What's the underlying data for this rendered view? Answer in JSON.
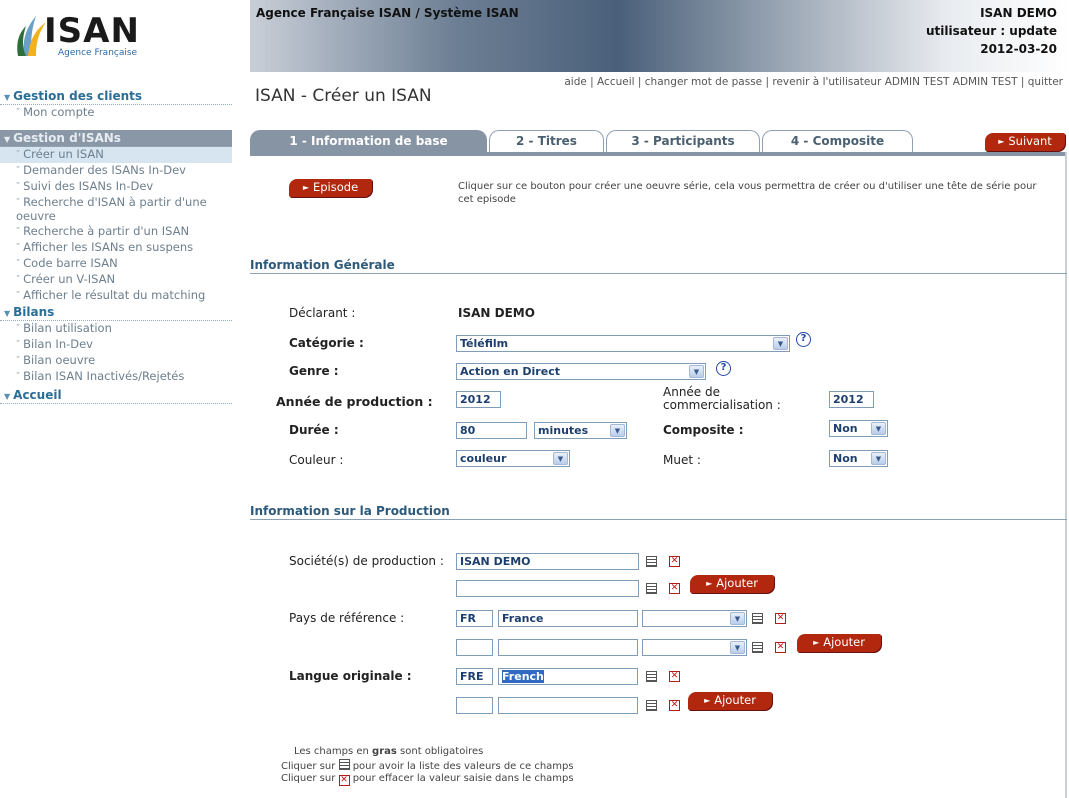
{
  "header": {
    "logo_text": "ISAN",
    "logo_sub": "Agence Française",
    "banner_title": "Agence Française ISAN / Système ISAN",
    "user_org": "ISAN DEMO",
    "user_line": "utilisateur : update",
    "date": "2012-03-20",
    "links": [
      "aide",
      "Accueil",
      "changer mot de passe",
      "revenir à l'utilisateur ADMIN TEST ADMIN TEST",
      "quitter"
    ]
  },
  "page_title": "ISAN - Créer un ISAN",
  "sidebar": {
    "sections": [
      {
        "title": "Gestion des clients",
        "items": [
          "Mon compte"
        ]
      },
      {
        "title": "Gestion d'ISANs",
        "items": [
          "Créer un ISAN",
          "Demander des ISANs In-Dev",
          "Suivi des ISANs In-Dev",
          "Recherche d'ISAN à partir d'une oeuvre",
          "Recherche à partir d'un ISAN",
          "Afficher les ISANs en suspens",
          "Code barre ISAN",
          "Créer un V-ISAN",
          "Afficher le résultat du matching"
        ]
      },
      {
        "title": "Bilans",
        "items": [
          "Bilan utilisation",
          "Bilan In-Dev",
          "Bilan oeuvre",
          "Bilan ISAN Inactivés/Rejetés"
        ]
      },
      {
        "title": "Accueil",
        "items": []
      }
    ]
  },
  "tabs": [
    "1 - Information de base",
    "2 - Titres",
    "3 - Participants",
    "4 - Composite"
  ],
  "next_button": "Suivant",
  "episode": {
    "button": "Episode",
    "hint": "Cliquer sur ce bouton pour créer une oeuvre série, cela vous permettra de créer ou d'utiliser une tête de série pour cet episode"
  },
  "general": {
    "title": "Information Générale",
    "declarant_label": "Déclarant :",
    "declarant_value": "ISAN DEMO",
    "categorie_label": "Catégorie :",
    "categorie_value": "Téléfilm",
    "genre_label": "Genre :",
    "genre_value": "Action en Direct",
    "annee_prod_label": "Année de production :",
    "annee_prod_value": "2012",
    "annee_comm_label_1": "Année de",
    "annee_comm_label_2": "commercialisation :",
    "annee_comm_value": "2012",
    "duree_label": "Durée :",
    "duree_value": "80",
    "duree_unit": "minutes",
    "composite_label": "Composite :",
    "composite_value": "Non",
    "couleur_label": "Couleur :",
    "couleur_value": "couleur",
    "muet_label": "Muet :",
    "muet_value": "Non"
  },
  "production": {
    "title": "Information sur la Production",
    "societe_label": "Société(s) de production :",
    "societe_value": "ISAN DEMO",
    "pays_label": "Pays de référence :",
    "pays_code": "FR",
    "pays_name": "France",
    "langue_label": "Langue originale :",
    "langue_code": "FRE",
    "langue_name": "French",
    "add_label": "Ajouter"
  },
  "footer": {
    "line1_a": "Les champs en ",
    "line1_b": "gras",
    "line1_c": " sont obligatoires",
    "line2_a": "Cliquer sur ",
    "line2_b": " pour avoir la liste des valeurs de ce champs",
    "line3_a": "Cliquer sur ",
    "line3_b": " pour effacer la valeur saisie dans le champs"
  },
  "icons": {
    "help": "help-icon",
    "list": "list-icon",
    "clear": "clear-icon",
    "dropdown": "chevron-down-icon"
  },
  "colors": {
    "accent": "#b2280e",
    "tab_active": "#8694a4",
    "link": "#2a6e96"
  }
}
